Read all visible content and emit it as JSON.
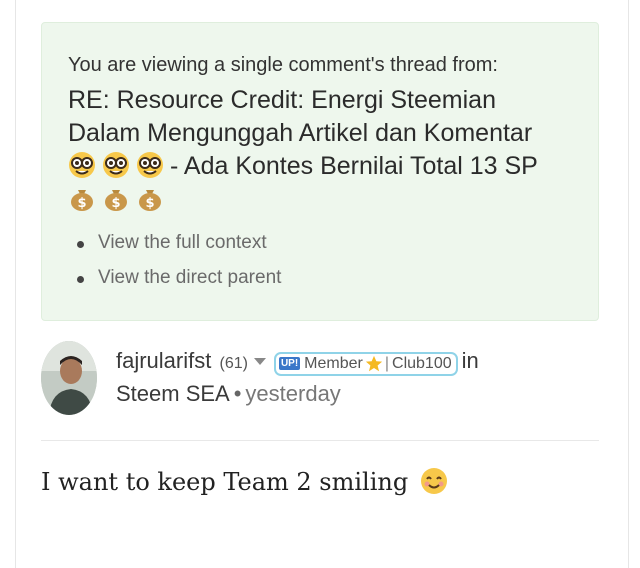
{
  "thread": {
    "intro": "You are viewing a single comment's thread from:",
    "title_line1": "RE: Resource Credit: Energi Steemian",
    "title_line2": "Dalam Mengunggah Artikel dan Komentar",
    "title_line3": "- Ada Kontes Bernilai Total 13 SP",
    "links": [
      "View the full context",
      "View the direct parent"
    ]
  },
  "comment": {
    "author": "fajrularifst",
    "reputation": "(61)",
    "badge": {
      "icon_text": "UP!",
      "left": "Member",
      "right": "Club100"
    },
    "in_word": "in",
    "community": "Steem SEA",
    "separator": "•",
    "time": "yesterday",
    "body": "I want to keep Team 2 smiling"
  },
  "colors": {
    "thread_bg": "#eef7ed",
    "badge_border": "#8fd3e8",
    "link_text": "#6a6a6a"
  },
  "icons": [
    "nerd-face-emoji",
    "money-bag-emoji",
    "caret-down-icon",
    "star-icon",
    "smiling-face-emoji"
  ]
}
